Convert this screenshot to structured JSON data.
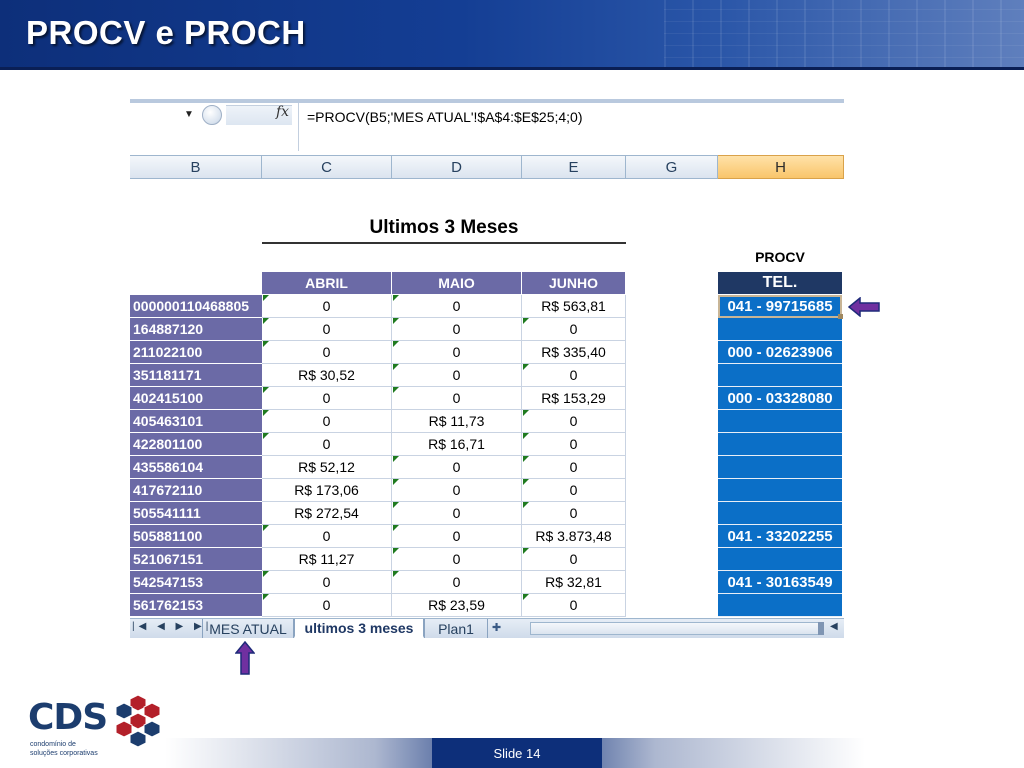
{
  "slide": {
    "title": "PROCV e PROCH",
    "number_label": "Slide 14"
  },
  "excel": {
    "fx_label": "fx",
    "formula": "=PROCV(B5;'MES ATUAL'!$A$4:$E$25;4;0)",
    "columns": [
      "B",
      "C",
      "D",
      "E",
      "G",
      "H"
    ],
    "active_column": "H",
    "sheet_title": "Ultimos 3 Meses",
    "table_headers": [
      "ABRIL",
      "MAIO",
      "JUNHO"
    ],
    "rows": [
      {
        "key": "000000110468805",
        "abril": "0",
        "maio": "0",
        "junho": "R$ 563,81"
      },
      {
        "key": "164887120",
        "abril": "0",
        "maio": "0",
        "junho": "0"
      },
      {
        "key": "211022100",
        "abril": "0",
        "maio": "0",
        "junho": "R$ 335,40"
      },
      {
        "key": "351181171",
        "abril": "R$ 30,52",
        "maio": "0",
        "junho": "0"
      },
      {
        "key": "402415100",
        "abril": "0",
        "maio": "0",
        "junho": "R$ 153,29"
      },
      {
        "key": "405463101",
        "abril": "0",
        "maio": "R$ 11,73",
        "junho": "0"
      },
      {
        "key": "422801100",
        "abril": "0",
        "maio": "R$ 16,71",
        "junho": "0"
      },
      {
        "key": "435586104",
        "abril": "R$ 52,12",
        "maio": "0",
        "junho": "0"
      },
      {
        "key": "417672110",
        "abril": "R$ 173,06",
        "maio": "0",
        "junho": "0"
      },
      {
        "key": "505541111",
        "abril": "R$ 272,54",
        "maio": "0",
        "junho": "0"
      },
      {
        "key": "505881100",
        "abril": "0",
        "maio": "0",
        "junho": "R$ 3.873,48"
      },
      {
        "key": "521067151",
        "abril": "R$ 11,27",
        "maio": "0",
        "junho": "0"
      },
      {
        "key": "542547153",
        "abril": "0",
        "maio": "0",
        "junho": "R$ 32,81"
      },
      {
        "key": "561762153",
        "abril": "0",
        "maio": "R$ 23,59",
        "junho": "0"
      }
    ],
    "procv_label": "PROCV",
    "tel_header": "TEL.",
    "tel_values": [
      "041 - 99715685",
      "",
      "000 - 02623906",
      "",
      "000 - 03328080",
      "",
      "",
      "",
      "",
      "",
      "041 - 33202255",
      "",
      "041 - 30163549",
      ""
    ],
    "sheet_tabs": [
      "MES ATUAL",
      "ultimos 3 meses",
      "Plan1"
    ],
    "active_tab": "ultimos 3 meses"
  },
  "logo": {
    "name": "CDS",
    "subtitle_line1": "condomínio de",
    "subtitle_line2": "soluções corporativas"
  },
  "colors": {
    "header_blue": "#0d2f7a",
    "table_purple": "#6b6aa6",
    "tel_blue": "#0b6fc7",
    "arrow_purple": "#7030a0",
    "logo_red": "#b3202a"
  }
}
